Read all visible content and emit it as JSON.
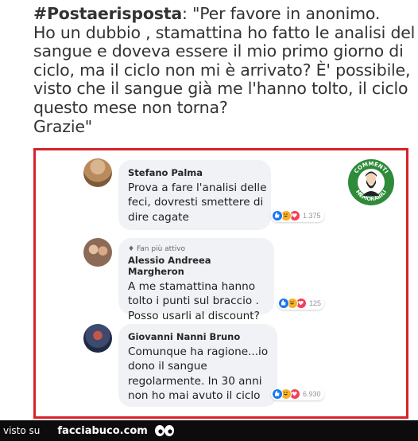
{
  "post": {
    "hashtag": "#Postaerisposta",
    "lines": [
      ": \"Per favore in anonimo.",
      "Ho un dubbio , stamattina ho fatto le analisi del",
      "sangue e doveva essere il mio primo giorno di",
      "ciclo, ma il ciclo non mi è arrivato? È' possibile,",
      "visto che il sangue già me l'hanno tolto, il ciclo",
      "questo mese non torna?",
      "Grazie\""
    ]
  },
  "seal": {
    "top_text": "COMMENTI",
    "bottom_text": "MEMORABILI",
    "color": "#2e8b3a"
  },
  "comments": [
    {
      "author": "Stefano Palma",
      "lines": [
        "Prova a fare l'analisi delle",
        "feci, dovresti smettere di",
        "dire cagate"
      ],
      "reaction_count": "1.375"
    },
    {
      "badge": "Fan più attivo",
      "author": "Alessio Andreea Margheron",
      "lines": [
        "A me stamattina hanno",
        "tolto i punti sul braccio .",
        "Posso usarli al discount?"
      ],
      "reaction_count": "125"
    },
    {
      "author": "Giovanni Nanni Bruno",
      "lines": [
        "Comunque ha ragione...io",
        "dono il sangue",
        "regolarmente. In 30 anni",
        "non ho mai avuto il ciclo"
      ],
      "reaction_count": "6.930"
    }
  ],
  "footer": {
    "visto_label": "visto su",
    "site_label": "facciabuco.com"
  },
  "colors": {
    "frame": "#d7222a",
    "like": "#1877f2",
    "haha": "#f7b125",
    "love": "#f33e58",
    "bubble": "#f0f2f5"
  }
}
